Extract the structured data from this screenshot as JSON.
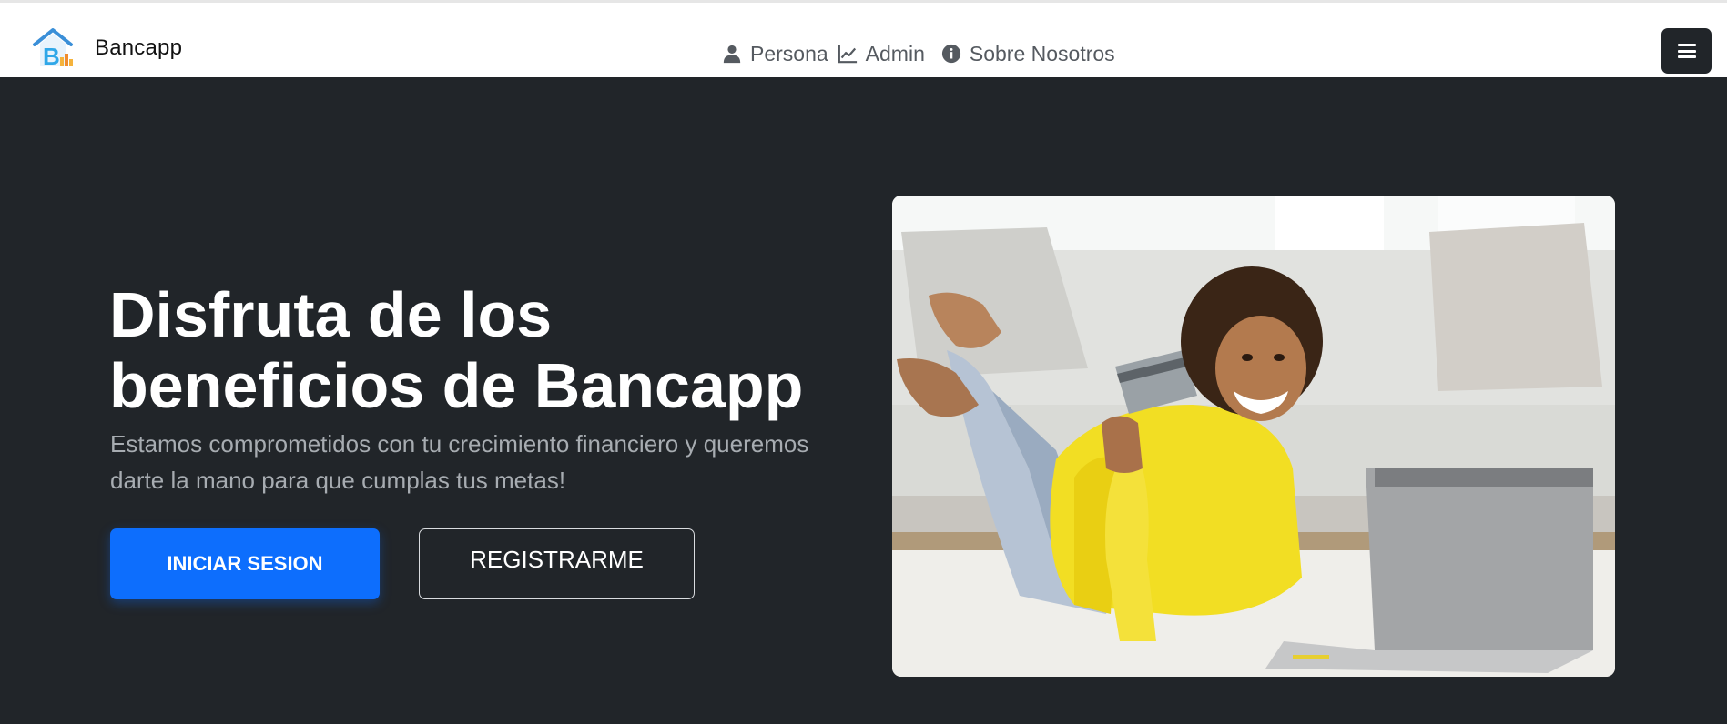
{
  "brand": {
    "name": "Bancapp",
    "logo_icon": "house-logo-icon"
  },
  "nav": {
    "items": [
      {
        "label": "Persona",
        "icon": "user-icon"
      },
      {
        "label": "Admin",
        "icon": "chart-line-icon"
      },
      {
        "label": "Sobre Nosotros",
        "icon": "info-circle-icon"
      }
    ],
    "toggler_icon": "hamburger-menu-icon"
  },
  "hero": {
    "title": "Disfruta de los beneficios de Bancapp",
    "subtitle": "Estamos comprometidos con tu crecimiento financiero y queremos darte la mano para que cumplas tus metas!",
    "primary_button": "INICIAR SESION",
    "secondary_button": "REGISTRARME",
    "image_subject": "woman with credit card and laptop"
  },
  "colors": {
    "hero_bg": "#212529",
    "primary": "#0d6efd",
    "nav_text": "#555a60"
  }
}
